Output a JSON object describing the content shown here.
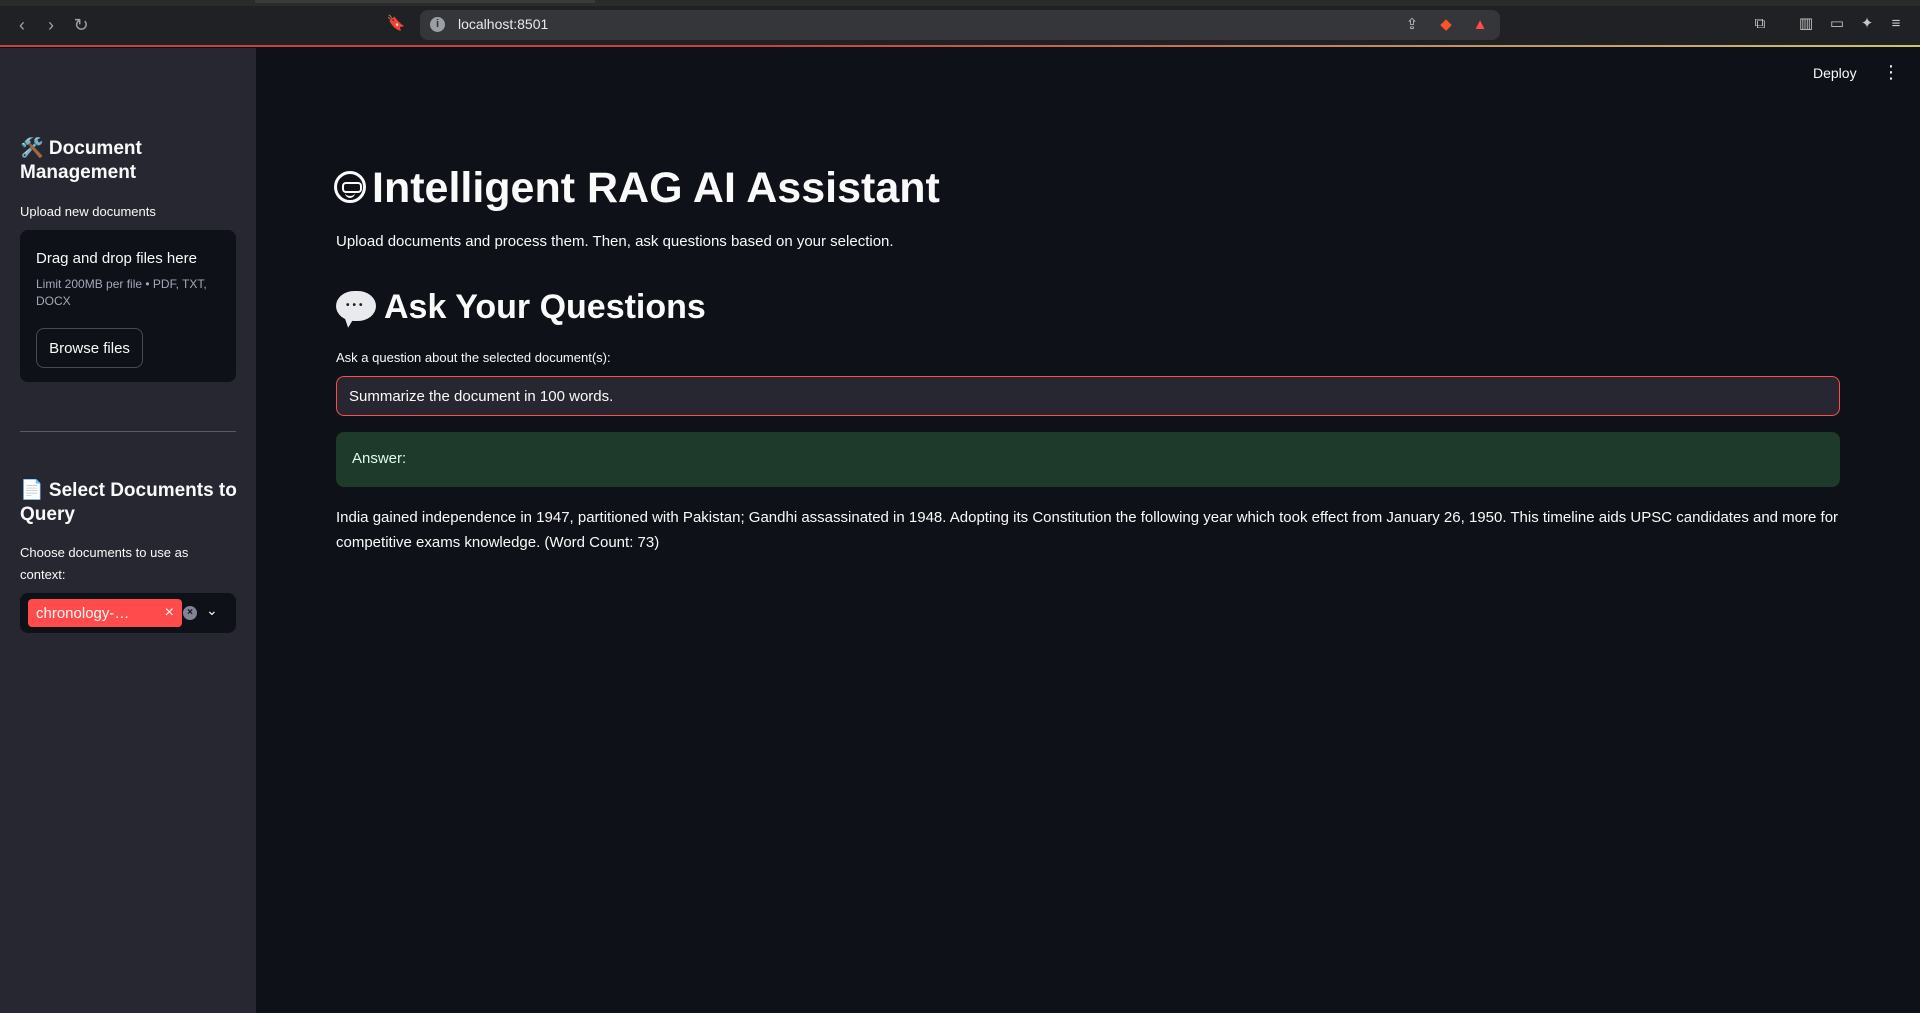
{
  "browser": {
    "url": "localhost:8501",
    "info_icon": "info-icon"
  },
  "sidebar": {
    "doc_mgmt_title": "🛠️ Document Management",
    "upload_label": "Upload new documents",
    "uploader_title": "Drag and drop files here",
    "uploader_sub": "Limit 200MB per file • PDF, TXT, DOCX",
    "browse_label": "Browse files",
    "select_title": "📄 Select Documents to Query",
    "select_label": "Choose documents to use as context:",
    "selected_chip": "chronology-…",
    "chip_remove": "×"
  },
  "header": {
    "deploy_label": "Deploy",
    "menu_icon": "⋮"
  },
  "main": {
    "title": "Intelligent RAG AI Assistant",
    "intro": "Upload documents and process them. Then, ask questions based on your selection.",
    "ask_heading": "Ask Your Questions",
    "question_label": "Ask a question about the selected document(s):",
    "question_value": "Summarize the document in 100 words.",
    "answer_label": "Answer:",
    "answer_text": "India gained independence in 1947, partitioned with Pakistan; Gandhi assassinated in 1948. Adopting its Constitution the following year which took effect from January 26, 1950. This timeline aids UPSC candidates and more for competitive exams knowledge. (Word Count: 73)"
  },
  "colors": {
    "accent": "#ff4b4b",
    "background": "#0e1117",
    "sidebar": "#262730",
    "success_bg": "#1d3a2a"
  }
}
